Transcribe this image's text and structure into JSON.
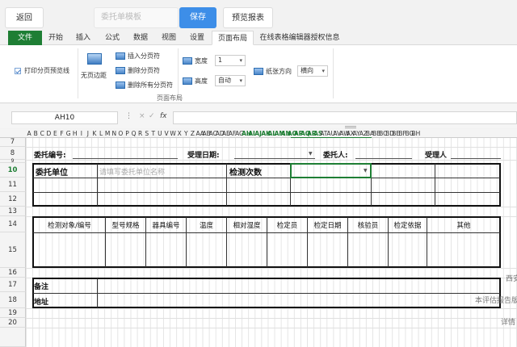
{
  "topbar": {
    "back_label": "返回",
    "template_placeholder": "委托单模板",
    "save_label": "保存",
    "preview_label": "预览报表"
  },
  "tabs": [
    "文件",
    "开始",
    "插入",
    "公式",
    "数据",
    "视图",
    "设置",
    "页面布局",
    "在线表格编辑器授权信息"
  ],
  "active_tab": "页面布局",
  "ribbon": {
    "print_preview_label": "打印分页预览线",
    "no_margin_label": "无页边距",
    "insert_break_label": "插入分页符",
    "delete_break_label": "删除分页符",
    "delete_all_breaks_label": "删除所有分页符",
    "width_label": "宽度",
    "width_value": "1",
    "height_label": "高度",
    "height_value": "自动",
    "direction_label": "纸张方向",
    "direction_value": "横向",
    "group_label": "页面布局"
  },
  "formula_bar": {
    "cell_ref": "AH10",
    "cancel_icon": "×",
    "confirm_icon": "✓",
    "fx_label": "fx",
    "formula_value": ""
  },
  "columns": "A B C D E F G H I J K L M N O P Q R S T U V W X Y Z AA AB AC AD AE AF AG AH AI AJ AK AL AM AN AO AP AQ AR AS AT AU AV AW AX AY AZ BA BB BC BD BE BF BG BH",
  "rows": [
    "7",
    "8",
    "9",
    "10",
    "11",
    "12",
    "13",
    "14",
    "15",
    "16",
    "17",
    "18",
    "19",
    "20"
  ],
  "active_row": "10",
  "sheet": {
    "entrust_no_label": "委托编号:",
    "accept_date_label": "受理日期:",
    "entruster_label": "委托人:",
    "acceptor_label": "受理人",
    "entrust_unit_label": "委托单位",
    "entrust_unit_placeholder": "请填写委托单位名称",
    "test_count_label": "检测次数",
    "table_headers": [
      "检测对象/编号",
      "型号规格",
      "器具编号",
      "温度",
      "相对湿度",
      "检定员",
      "检定日期",
      "核验员",
      "检定依据",
      "其他"
    ],
    "remark_label": "备注",
    "address_label": "地址",
    "side_text_1": "西安",
    "side_text_2": "本评估报告版本(",
    "side_text_3": "详情"
  }
}
